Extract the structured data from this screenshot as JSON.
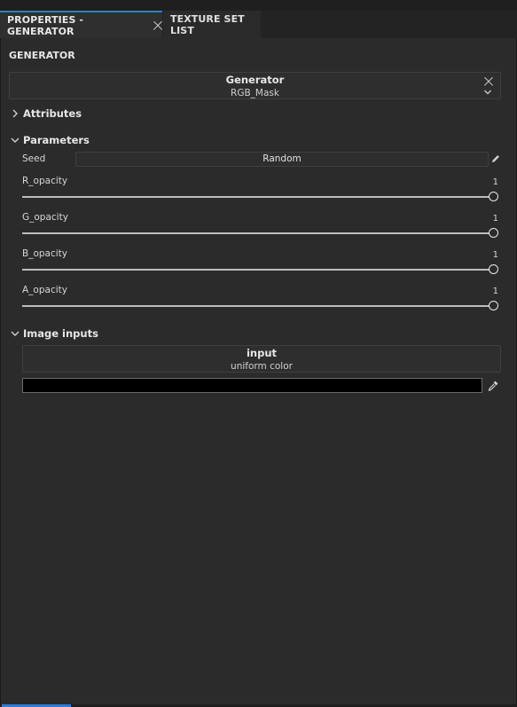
{
  "tabs": [
    {
      "label": "PROPERTIES - GENERATOR",
      "active": true
    },
    {
      "label": "TEXTURE SET LIST",
      "active": false
    }
  ],
  "section_title": "GENERATOR",
  "generator": {
    "title": "Generator",
    "value": "RGB_Mask"
  },
  "groups": {
    "attributes": "Attributes",
    "parameters": "Parameters",
    "image_inputs": "Image inputs"
  },
  "seed": {
    "label": "Seed",
    "button": "Random"
  },
  "sliders": [
    {
      "label": "R_opacity",
      "value": "1"
    },
    {
      "label": "G_opacity",
      "value": "1"
    },
    {
      "label": "B_opacity",
      "value": "1"
    },
    {
      "label": "A_opacity",
      "value": "1"
    }
  ],
  "image_input": {
    "title": "input",
    "value": "uniform color",
    "color": "#000000"
  },
  "colors": {
    "accent": "#2f7bd9",
    "background": "#2b2b2b"
  },
  "icons": {
    "tab_close": "close-icon",
    "generator_close": "close-icon",
    "generator_dropdown": "chevron-down-icon",
    "seed_edit": "pencil-icon",
    "color_picker": "eyedropper-icon"
  }
}
